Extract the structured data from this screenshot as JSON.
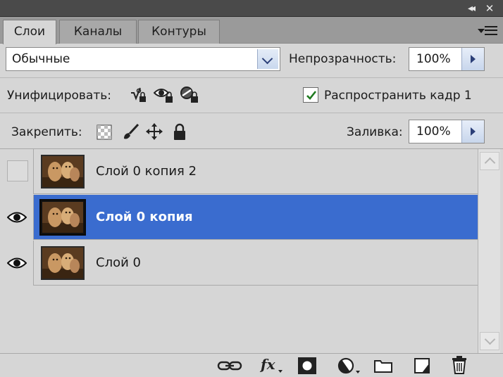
{
  "window": {
    "collapse_icon": "double-chevron-right-icon",
    "close_icon": "close-icon"
  },
  "tabs": [
    {
      "label": "Слои",
      "active": true
    },
    {
      "label": "Каналы",
      "active": false
    },
    {
      "label": "Контуры",
      "active": false
    }
  ],
  "panel_menu_icon": "panel-menu-icon",
  "blend": {
    "mode": "Обычные",
    "opacity_label": "Непрозрачность:",
    "opacity_value": "100%"
  },
  "unify": {
    "label": "Унифицировать:",
    "icons": [
      "unify-position-icon",
      "unify-visibility-icon",
      "unify-style-icon"
    ],
    "propagate_label": "Распространить кадр 1",
    "propagate_checked": true
  },
  "lock": {
    "label": "Закрепить:",
    "icons": [
      "lock-transparency-icon",
      "lock-pixels-icon",
      "lock-position-icon",
      "lock-all-icon"
    ],
    "fill_label": "Заливка:",
    "fill_value": "100%"
  },
  "layers": [
    {
      "name": "Слой 0 копия 2",
      "visible": false,
      "selected": false
    },
    {
      "name": "Слой 0 копия",
      "visible": true,
      "selected": true
    },
    {
      "name": "Слой 0",
      "visible": true,
      "selected": false
    }
  ],
  "footer_icons": [
    "link-layers-icon",
    "fx-icon",
    "layer-mask-icon",
    "adjustment-layer-icon",
    "new-group-icon",
    "new-layer-icon",
    "trash-icon"
  ],
  "colors": {
    "selected_row": "#3a6ccf",
    "panel_bg": "#d6d6d6",
    "titlebar": "#4a4a4a"
  }
}
